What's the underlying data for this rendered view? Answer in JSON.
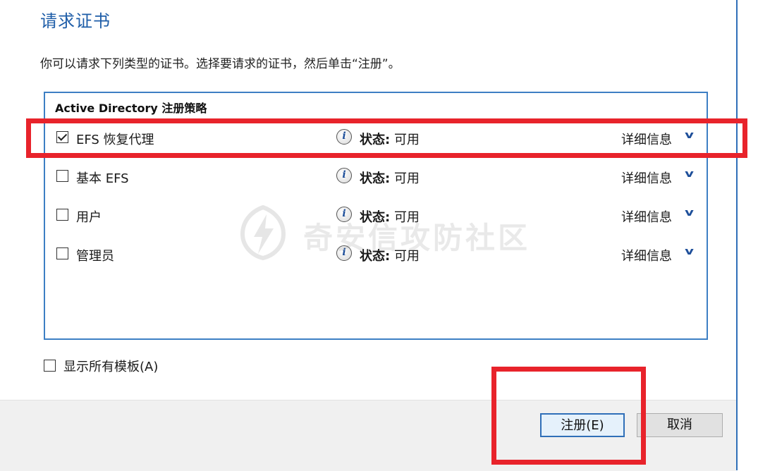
{
  "dialog": {
    "title": "请求证书",
    "description": "你可以请求下列类型的证书。选择要请求的证书，然后单击“注册”。"
  },
  "policy_group": {
    "header": "Active Directory 注册策略",
    "items": [
      {
        "label": "EFS 恢复代理",
        "checked": true,
        "status_label": "状态:",
        "status_value": "可用",
        "details_label": "详细信息"
      },
      {
        "label": "基本 EFS",
        "checked": false,
        "status_label": "状态:",
        "status_value": "可用",
        "details_label": "详细信息"
      },
      {
        "label": "用户",
        "checked": false,
        "status_label": "状态:",
        "status_value": "可用",
        "details_label": "详细信息"
      },
      {
        "label": "管理员",
        "checked": false,
        "status_label": "状态:",
        "status_value": "可用",
        "details_label": "详细信息"
      }
    ]
  },
  "show_all_templates": {
    "label": "显示所有模板(A)",
    "checked": false
  },
  "footer": {
    "enroll_label": "注册(E)",
    "cancel_label": "取消"
  },
  "watermark": {
    "text": "奇安信攻防社区"
  },
  "colors": {
    "accent": "#1e5da8",
    "highlight": "#e8232b",
    "border": "#3d7fc4"
  },
  "icons": {
    "info": "info-icon",
    "chevron": "chevron-down-icon",
    "watermark_logo": "lightning-shield-icon"
  }
}
